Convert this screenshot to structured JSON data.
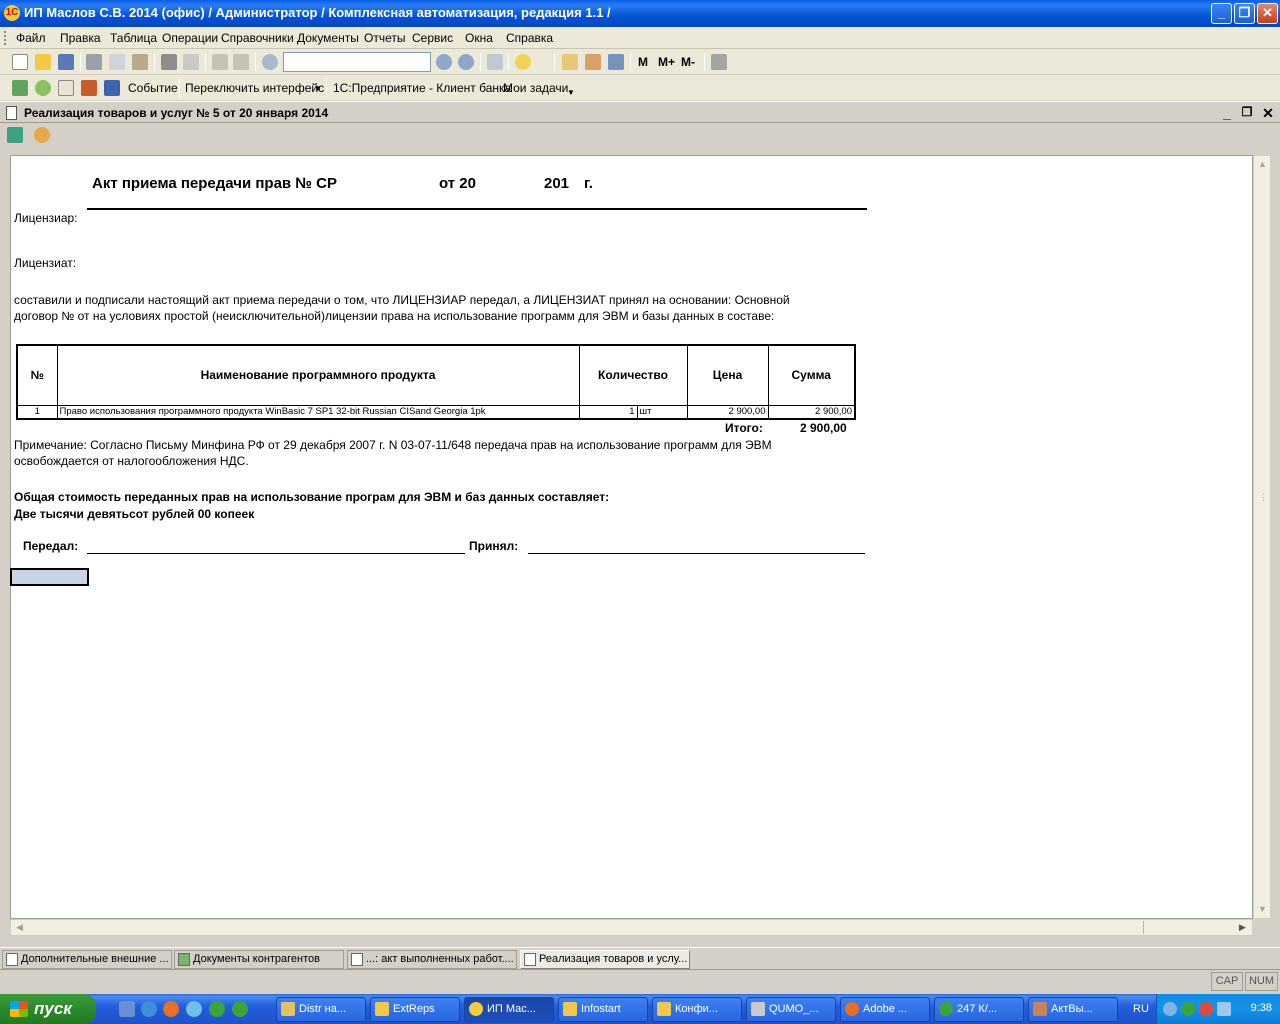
{
  "window": {
    "title": "ИП Маслов С.В. 2014 (офис) / Администратор /  Комплексная автоматизация, редакция 1.1 /",
    "app_icon": "1C",
    "controls": {
      "minimize": "_",
      "maximize": "❐",
      "close": "✕"
    }
  },
  "menu": [
    "Файл",
    "Правка",
    "Таблица",
    "Операции",
    "Справочники",
    "Документы",
    "Отчеты",
    "Сервис",
    "Окна",
    "Справка"
  ],
  "toolbar2": {
    "calc_labels": [
      "M",
      "M+",
      "M-"
    ],
    "search_value": ""
  },
  "toolbar3": {
    "event": "Событие",
    "switch_interface": "Переключить интерфейс",
    "bank_client": "1С:Предприятие - Клиент банка",
    "my_tasks": "Мои задачи"
  },
  "doc_window": {
    "title": "Реализация товаров и услуг № 5 от 20 января 2014"
  },
  "document": {
    "heading": "Акт приема передачи прав № СР",
    "heading_from": "от 20",
    "heading_year": "201",
    "heading_g": "г.",
    "licensor_label": "Лицензиар:",
    "licensee_label": "Лицензиат:",
    "para_line1": "составили и подписали настоящий акт приема передачи о том, что ЛИЦЕНЗИАР передал, а ЛИЦЕНЗИАТ принял на основании: Основной",
    "para_line2": "договор №    от    на условиях простой (неисключительной)лицензии права на использование программ для ЭВМ и базы данных в составе:",
    "table": {
      "headers": [
        "№",
        "Наименование программного продукта",
        "Количество",
        "Цена",
        "Сумма"
      ],
      "rows": [
        {
          "num": "1",
          "name": "Право использования программного продукта WinBasic 7 SP1 32-bit Russian CISand Georgia 1pk",
          "qty": "1",
          "unit": "шт",
          "price": "2 900,00",
          "sum": "2 900,00"
        }
      ],
      "total_label": "Итого:",
      "total_value": "2 900,00"
    },
    "note_line1": "Примечание: Согласно Письму Минфина РФ от 29 декабря 2007 г. N 03-07-11/648 передача прав на использование программ для ЭВМ",
    "note_line2": "освобождается от налогообложения НДС.",
    "total_line1": "Общая стоимость переданных прав на использование програм для ЭВМ и баз данных составляет:",
    "total_line2": "Две тысячи девятьсот рублей 00 копеек",
    "handed_label": "Передал:",
    "received_label": "Принял:"
  },
  "window_tabs": [
    "Дополнительные внешние ...",
    "Документы контрагентов",
    "...: акт выполненных работ....",
    "Реализация товаров и услу..."
  ],
  "status": {
    "cap": "CAP",
    "num": "NUM"
  },
  "taskbar": {
    "start": "пуск",
    "tasks": [
      "Distr на...",
      "ExtReps",
      "ИП Мас...",
      "Infostart",
      "Конфи...",
      "QUMO_...",
      "Adobe ...",
      "247 К/...",
      "АктВы..."
    ],
    "lang": "RU",
    "clock": "9:38"
  },
  "colors": {
    "title_bar": "#0a5ee8",
    "taskbar": "#245edc",
    "start": "#2a8a2a"
  }
}
